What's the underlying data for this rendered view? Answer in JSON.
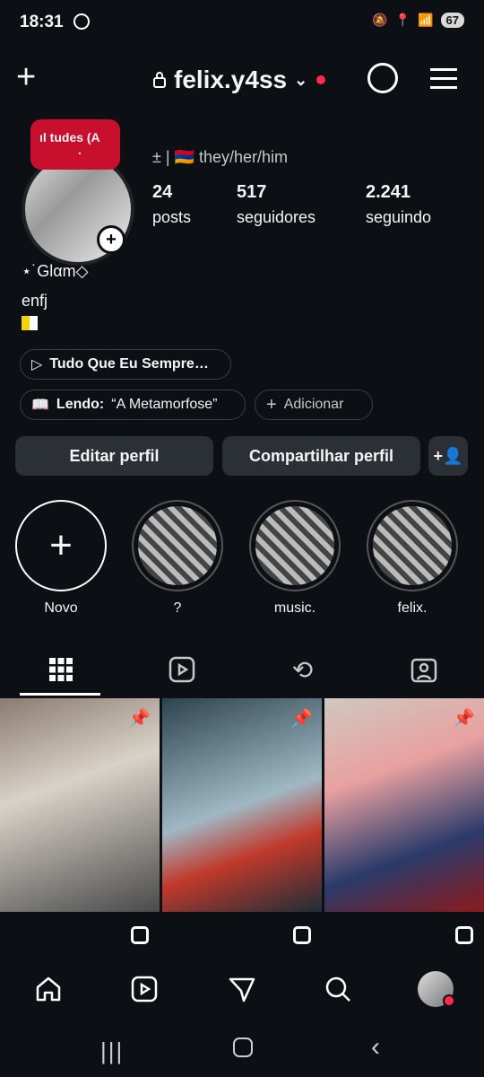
{
  "status": {
    "time": "18:31",
    "battery": "67"
  },
  "header": {
    "username": "felix.y4ss"
  },
  "note": {
    "text": "tudes (A",
    "text2": "."
  },
  "profile": {
    "pronouns": "± | 🇦🇲 they/her/him",
    "stats": [
      {
        "value": "24",
        "label": "posts"
      },
      {
        "value": "517",
        "label": "seguidores"
      },
      {
        "value": "2.241",
        "label": "seguindo"
      }
    ],
    "name": "⋆˙Glαm◇",
    "bio": "enfj"
  },
  "pills": {
    "music": "Tudo Que Eu Sempre…",
    "reading_label": "Lendo:",
    "reading_value": "“A Metamorfose”",
    "add": "Adicionar"
  },
  "actions": {
    "edit": "Editar perfil",
    "share": "Compartilhar perfil"
  },
  "highlights": [
    {
      "label": "Novo"
    },
    {
      "label": "?"
    },
    {
      "label": "music."
    },
    {
      "label": "felix."
    }
  ]
}
